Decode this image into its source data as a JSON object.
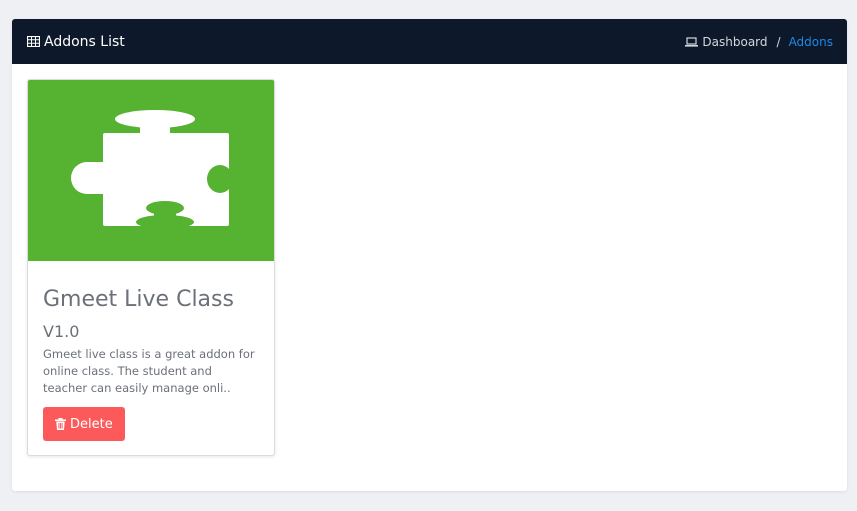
{
  "header": {
    "title": "Addons List",
    "title_icon": "table-icon"
  },
  "breadcrumb": {
    "home_label": "Dashboard",
    "home_icon": "laptop-icon",
    "separator": "/",
    "current": "Addons"
  },
  "addons": [
    {
      "name": "Gmeet Live Class",
      "version": "V1.0",
      "description": "Gmeet live class is a great addon for online class. The student and teacher can easily manage onli..",
      "image_icon": "puzzle-piece-icon",
      "image_bg": "#56b231",
      "delete_label": "Delete",
      "delete_icon": "trash-icon"
    }
  ],
  "colors": {
    "header_bg": "#0d192b",
    "page_bg": "#eff0f4",
    "link_active": "#1e88e5",
    "delete_bg": "#fc5a5a"
  }
}
